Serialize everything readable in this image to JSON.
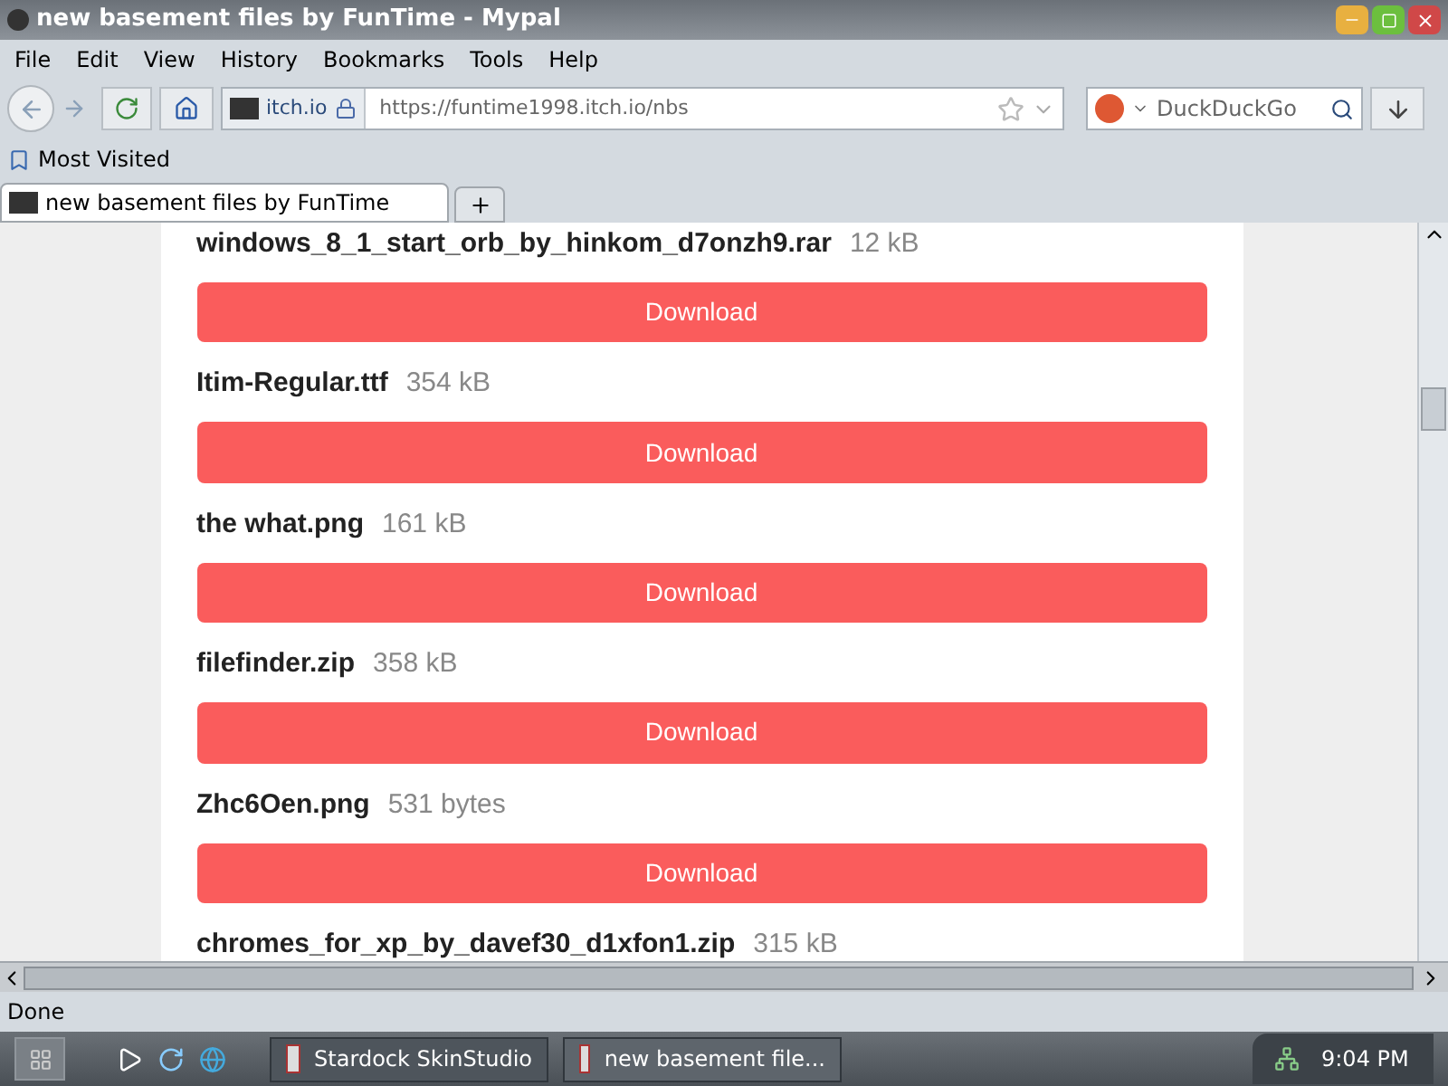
{
  "window": {
    "title": "new basement files by FunTime - Mypal"
  },
  "menu": [
    "File",
    "Edit",
    "View",
    "History",
    "Bookmarks",
    "Tools",
    "Help"
  ],
  "address": {
    "site": "itch.io",
    "url": "https://funtime1998.itch.io/nbs"
  },
  "search": {
    "placeholder": "DuckDuckGo"
  },
  "bookmarks": [
    "Most Visited"
  ],
  "tabs": [
    {
      "label": "new basement files by FunTime",
      "selected": true
    }
  ],
  "files": [
    {
      "name": "windows_8_1_start_orb_by_hinkom_d7onzh9.rar",
      "size": "12 kB"
    },
    {
      "button": "Download",
      "name": "Itim-Regular.ttf",
      "size": "354 kB"
    },
    {
      "button": "Download",
      "name": "the what.png",
      "size": "161 kB"
    },
    {
      "button": "Download",
      "name": "filefinder.zip",
      "size": "358 kB"
    },
    {
      "button": "Download",
      "name": "Zhc6Oen.png",
      "size": "531 bytes"
    },
    {
      "button": "Download",
      "name": "chromes_for_xp_by_davef30_d1xfon1.zip",
      "size": "315 kB"
    }
  ],
  "status_bar": "Done",
  "taskbar": {
    "tasks": [
      {
        "label": "Stardock SkinStudio",
        "selected": false
      },
      {
        "label": "new basement file...",
        "selected": true
      }
    ],
    "clock": "9:04 PM"
  }
}
